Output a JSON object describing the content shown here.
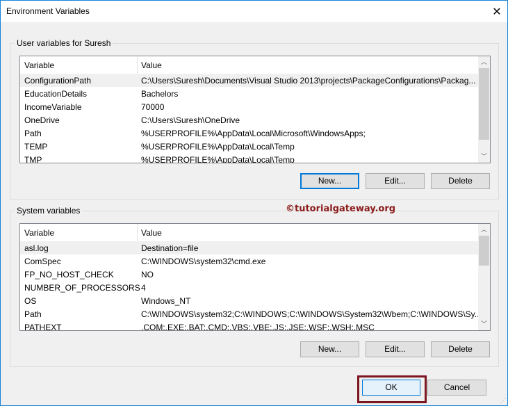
{
  "window": {
    "title": "Environment Variables",
    "close_icon": "close-icon"
  },
  "user": {
    "label": "User variables for Suresh",
    "columns": [
      "Variable",
      "Value"
    ],
    "rows": [
      {
        "var": "ConfigurationPath",
        "val": "C:\\Users\\Suresh\\Documents\\Visual Studio 2013\\projects\\PackageConfigurations\\Packag..."
      },
      {
        "var": "EducationDetails",
        "val": "Bachelors"
      },
      {
        "var": "IncomeVariable",
        "val": "70000"
      },
      {
        "var": "OneDrive",
        "val": "C:\\Users\\Suresh\\OneDrive"
      },
      {
        "var": "Path",
        "val": "%USERPROFILE%\\AppData\\Local\\Microsoft\\WindowsApps;"
      },
      {
        "var": "TEMP",
        "val": "%USERPROFILE%\\AppData\\Local\\Temp"
      },
      {
        "var": "TMP",
        "val": "%USERPROFILE%\\AppData\\Local\\Temp"
      }
    ],
    "buttons": {
      "new": "New...",
      "edit": "Edit...",
      "delete": "Delete"
    }
  },
  "system": {
    "label": "System variables",
    "columns": [
      "Variable",
      "Value"
    ],
    "rows": [
      {
        "var": "asl.log",
        "val": "Destination=file"
      },
      {
        "var": "ComSpec",
        "val": "C:\\WINDOWS\\system32\\cmd.exe"
      },
      {
        "var": "FP_NO_HOST_CHECK",
        "val": "NO"
      },
      {
        "var": "NUMBER_OF_PROCESSORS",
        "val": "4"
      },
      {
        "var": "OS",
        "val": "Windows_NT"
      },
      {
        "var": "Path",
        "val": "C:\\WINDOWS\\system32;C:\\WINDOWS;C:\\WINDOWS\\System32\\Wbem;C:\\WINDOWS\\Sy..."
      },
      {
        "var": "PATHEXT",
        "val": ".COM;.EXE;.BAT;.CMD;.VBS;.VBE;.JS;.JSE;.WSF;.WSH;.MSC"
      }
    ],
    "buttons": {
      "new": "New...",
      "edit": "Edit...",
      "delete": "Delete"
    }
  },
  "watermark": "©tutorialgateway.org",
  "footer": {
    "ok": "OK",
    "cancel": "Cancel"
  },
  "colors": {
    "accent": "#0078d7",
    "highlight": "#7b1520"
  }
}
